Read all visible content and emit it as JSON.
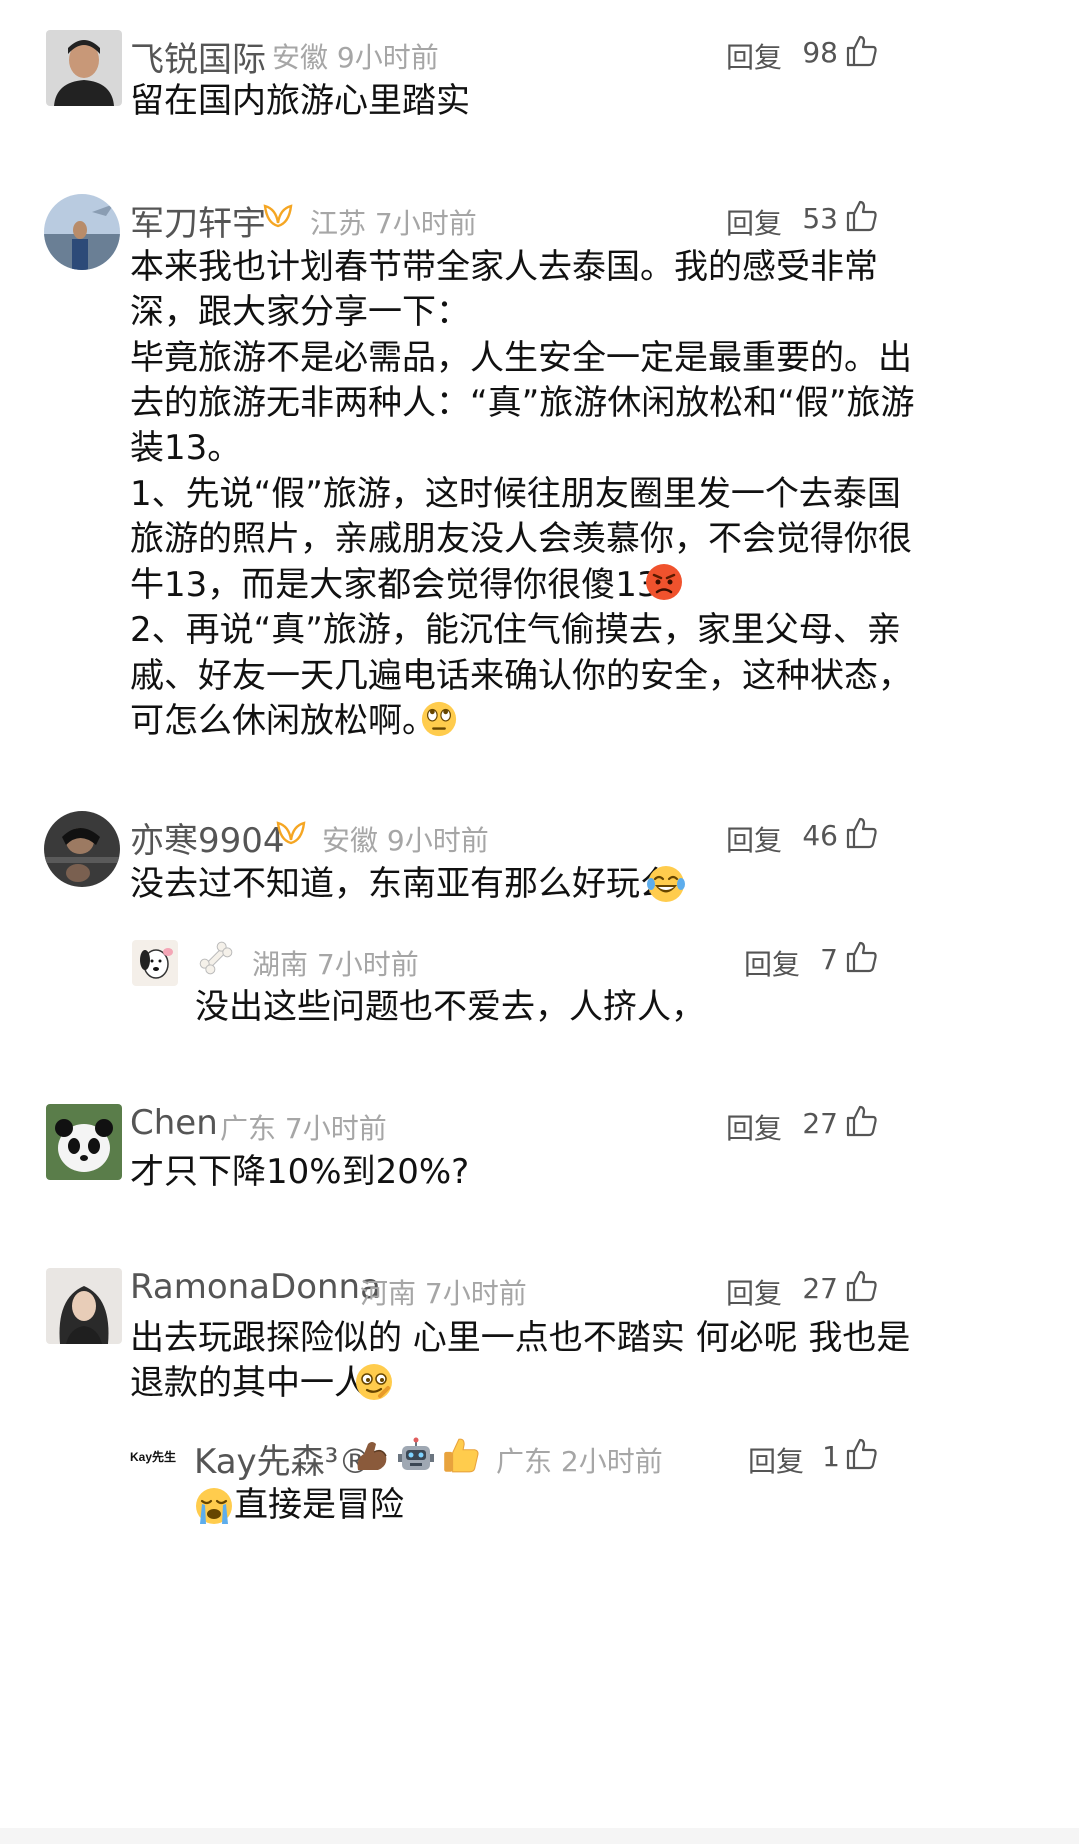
{
  "comments": [
    {
      "name": "飞锐国际",
      "region": "安徽",
      "time": "9小时前",
      "reply_label": "回复",
      "likes": "98",
      "text": "留在国内旅游心里踏实"
    },
    {
      "name": "军刀轩宇",
      "region": "江苏",
      "time": "7小时前",
      "reply_label": "回复",
      "likes": "53",
      "lines": [
        "本来我也计划春节带全家人去泰国。我的感受非常",
        "深，跟大家分享一下：",
        "毕竟旅游不是必需品，人生安全一定是最重要的。出",
        "去的旅游无非两种人：“真”旅游休闲放松和“假”旅游",
        "装13。",
        "1、先说“假”旅游，这时候往朋友圈里发一个去泰国",
        "旅游的照片，亲戚朋友没人会羡慕你，不会觉得你很",
        "牛13，而是大家都会觉得你很傻13。",
        "2、再说“真”旅游，能沉住气偷摸去，家里父母、亲",
        "戚、好友一天几遍电话来确认你的安全，这种状态，",
        "可怎么休闲放松啊。"
      ]
    },
    {
      "name": "亦寒9904",
      "region": "安徽",
      "time": "9小时前",
      "reply_label": "回复",
      "likes": "46",
      "text": "没去过不知道，东南亚有那么好玩么"
    },
    {
      "name": "",
      "region": "湖南",
      "time": "7小时前",
      "reply_label": "回复",
      "likes": "7",
      "text": "没出这些问题也不爱去，人挤人，"
    },
    {
      "name": "Chen",
      "region": "广东",
      "time": "7小时前",
      "reply_label": "回复",
      "likes": "27",
      "text": "才只下降10%到20%?"
    },
    {
      "name": "RamonaDonna",
      "region": "河南",
      "time": "7小时前",
      "reply_label": "回复",
      "likes": "27",
      "lines": [
        "出去玩跟探险似的 心里一点也不踏实 何必呢 我也是",
        "退款的其中一人"
      ]
    },
    {
      "name": "Kay先森³®",
      "region": "广东",
      "time": "2小时前",
      "reply_label": "回复",
      "likes": "1",
      "avatar_text": "Kay先生",
      "text": "直接是冒险"
    }
  ],
  "colors": {
    "name": "#555555",
    "meta": "#a6a6a6",
    "text": "#111111",
    "badge": "#f5a623"
  },
  "icons": [
    "thumbs-up-icon",
    "vip-badge-icon",
    "bone-icon",
    "emoji-icons"
  ]
}
